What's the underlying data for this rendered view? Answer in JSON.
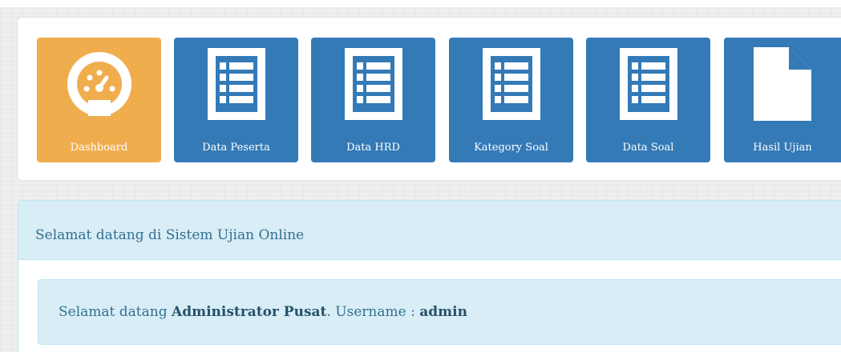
{
  "menu": {
    "tiles": [
      {
        "label": "Dashboard",
        "icon": "dashboard-gauge-icon",
        "color": "#f0ad4e"
      },
      {
        "label": "Data Peserta",
        "icon": "list-icon",
        "color": "#337ab7"
      },
      {
        "label": "Data HRD",
        "icon": "list-icon",
        "color": "#337ab7"
      },
      {
        "label": "Kategory Soal",
        "icon": "list-icon",
        "color": "#337ab7"
      },
      {
        "label": "Data Soal",
        "icon": "list-icon",
        "color": "#337ab7"
      },
      {
        "label": "Hasil Ujian",
        "icon": "file-icon",
        "color": "#337ab7"
      }
    ]
  },
  "welcome": {
    "heading": "Selamat datang di Sistem Ujian Online",
    "prefix": "Selamat datang ",
    "name": "Administrator Pusat",
    "middle": ". Username : ",
    "username": "admin"
  },
  "colors": {
    "info_bg": "#d9edf7",
    "info_border": "#bce8f1",
    "info_text": "#31708f",
    "primary": "#337ab7",
    "warning": "#f0ad4e"
  }
}
